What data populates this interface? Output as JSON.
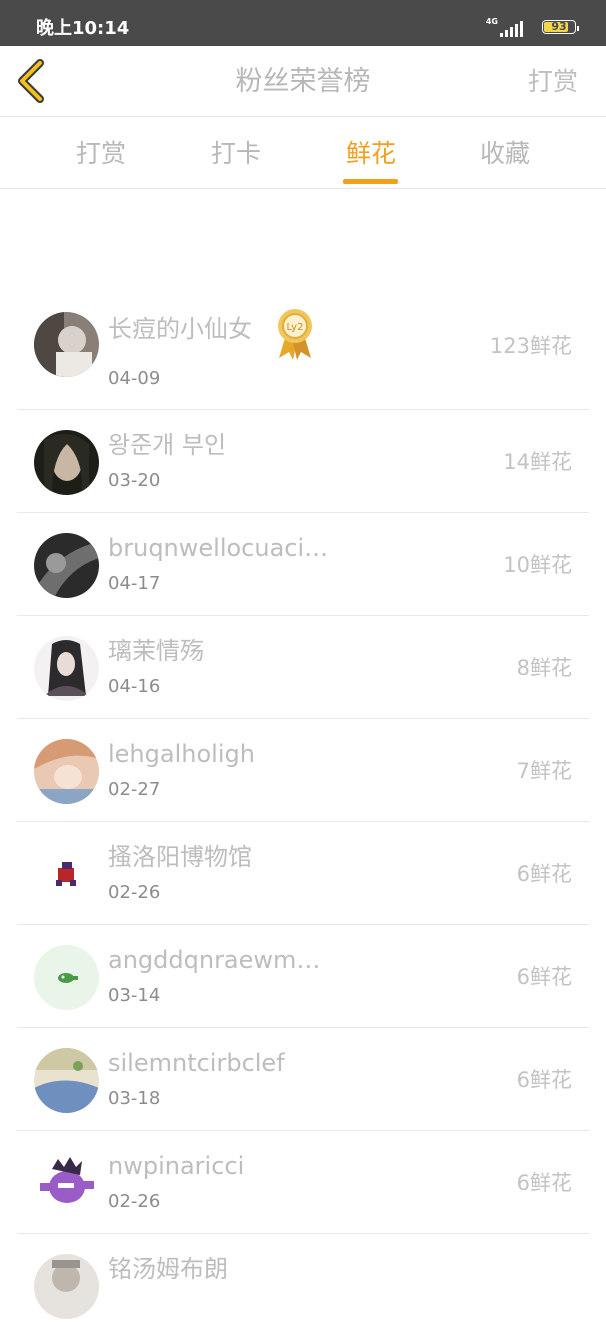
{
  "status": {
    "time": "晚上10:14",
    "network": "4G",
    "battery": "93"
  },
  "nav": {
    "title": "粉丝荣誉榜",
    "action": "打赏"
  },
  "tabs": [
    {
      "label": "打赏"
    },
    {
      "label": "打卡"
    },
    {
      "label": "鲜花"
    },
    {
      "label": "收藏"
    }
  ],
  "badge_text": "Ly2",
  "rows": [
    {
      "name": "长痘的小仙女",
      "date": "04-09",
      "count": "123鲜花"
    },
    {
      "name": "왕준개 부인",
      "date": "03-20",
      "count": "14鲜花"
    },
    {
      "name": "bruqnwellocuaci…",
      "date": "04-17",
      "count": "10鲜花"
    },
    {
      "name": "璃茉情殇",
      "date": "04-16",
      "count": "8鲜花"
    },
    {
      "name": "lehgalholigh",
      "date": "02-27",
      "count": "7鲜花"
    },
    {
      "name": "搔洛阳博物馆",
      "date": "02-26",
      "count": "6鲜花"
    },
    {
      "name": "angddqnraewm…",
      "date": "03-14",
      "count": "6鲜花"
    },
    {
      "name": "silemntcirbclef",
      "date": "03-18",
      "count": "6鲜花"
    },
    {
      "name": "nwpinaricci",
      "date": "02-26",
      "count": "6鲜花"
    },
    {
      "name": "铭汤姆布朗",
      "date": "",
      "count": ""
    }
  ],
  "colors": {
    "accent": "#f2a01e",
    "statusbar": "#4a4a4a"
  }
}
